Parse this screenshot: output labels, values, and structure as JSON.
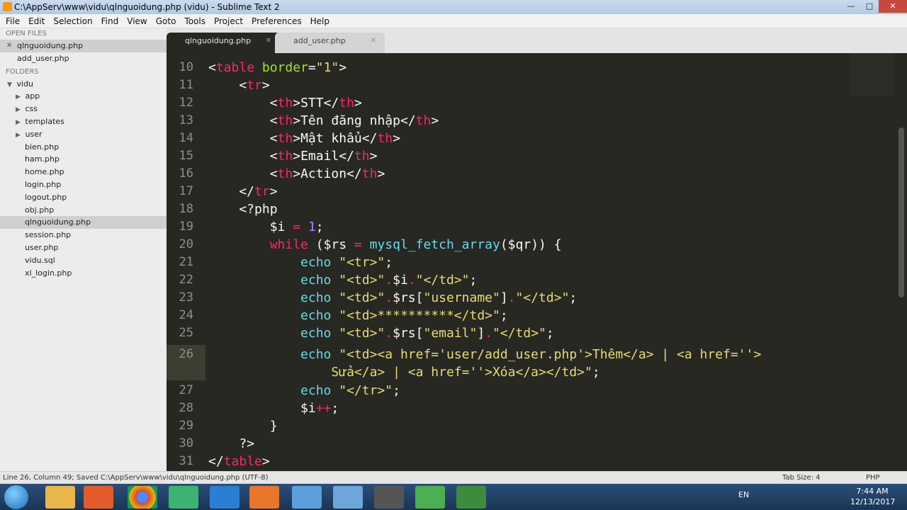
{
  "window": {
    "title": "C:\\AppServ\\www\\vidu\\qlnguoidung.php (vidu) - Sublime Text 2"
  },
  "menu": [
    "File",
    "Edit",
    "Selection",
    "Find",
    "View",
    "Goto",
    "Tools",
    "Project",
    "Preferences",
    "Help"
  ],
  "sidebar": {
    "open_files_label": "OPEN FILES",
    "open_files": [
      "qlnguoidung.php",
      "add_user.php"
    ],
    "folders_label": "FOLDERS",
    "root": "vidu",
    "folders": [
      "app",
      "css",
      "templates",
      "user"
    ],
    "files": [
      "bien.php",
      "ham.php",
      "home.php",
      "login.php",
      "logout.php",
      "obj.php",
      "qlnguoidung.php",
      "session.php",
      "user.php",
      "vidu.sql",
      "xl_login.php"
    ]
  },
  "tabs": [
    {
      "label": "qlnguoidung.php",
      "active": true
    },
    {
      "label": "add_user.php",
      "active": false
    }
  ],
  "editor": {
    "lines": [
      {
        "n": "10"
      },
      {
        "n": "11"
      },
      {
        "n": "12"
      },
      {
        "n": "13"
      },
      {
        "n": "14"
      },
      {
        "n": "15"
      },
      {
        "n": "16"
      },
      {
        "n": "17"
      },
      {
        "n": "18"
      },
      {
        "n": "19"
      },
      {
        "n": "20"
      },
      {
        "n": "21"
      },
      {
        "n": "22"
      },
      {
        "n": "23"
      },
      {
        "n": "24"
      },
      {
        "n": "25"
      },
      {
        "n": "26"
      },
      {
        "n": "27"
      },
      {
        "n": "28"
      },
      {
        "n": "29"
      },
      {
        "n": "30"
      },
      {
        "n": "31"
      }
    ]
  },
  "status": {
    "left": "Line 26, Column 49; Saved C:\\AppServ\\www\\vidu\\qlnguoidung.php (UTF-8)",
    "tab_size": "Tab Size: 4",
    "syntax": "PHP"
  },
  "taskbar": {
    "lang": "EN",
    "time": "7:44 AM",
    "date": "12/13/2017"
  }
}
